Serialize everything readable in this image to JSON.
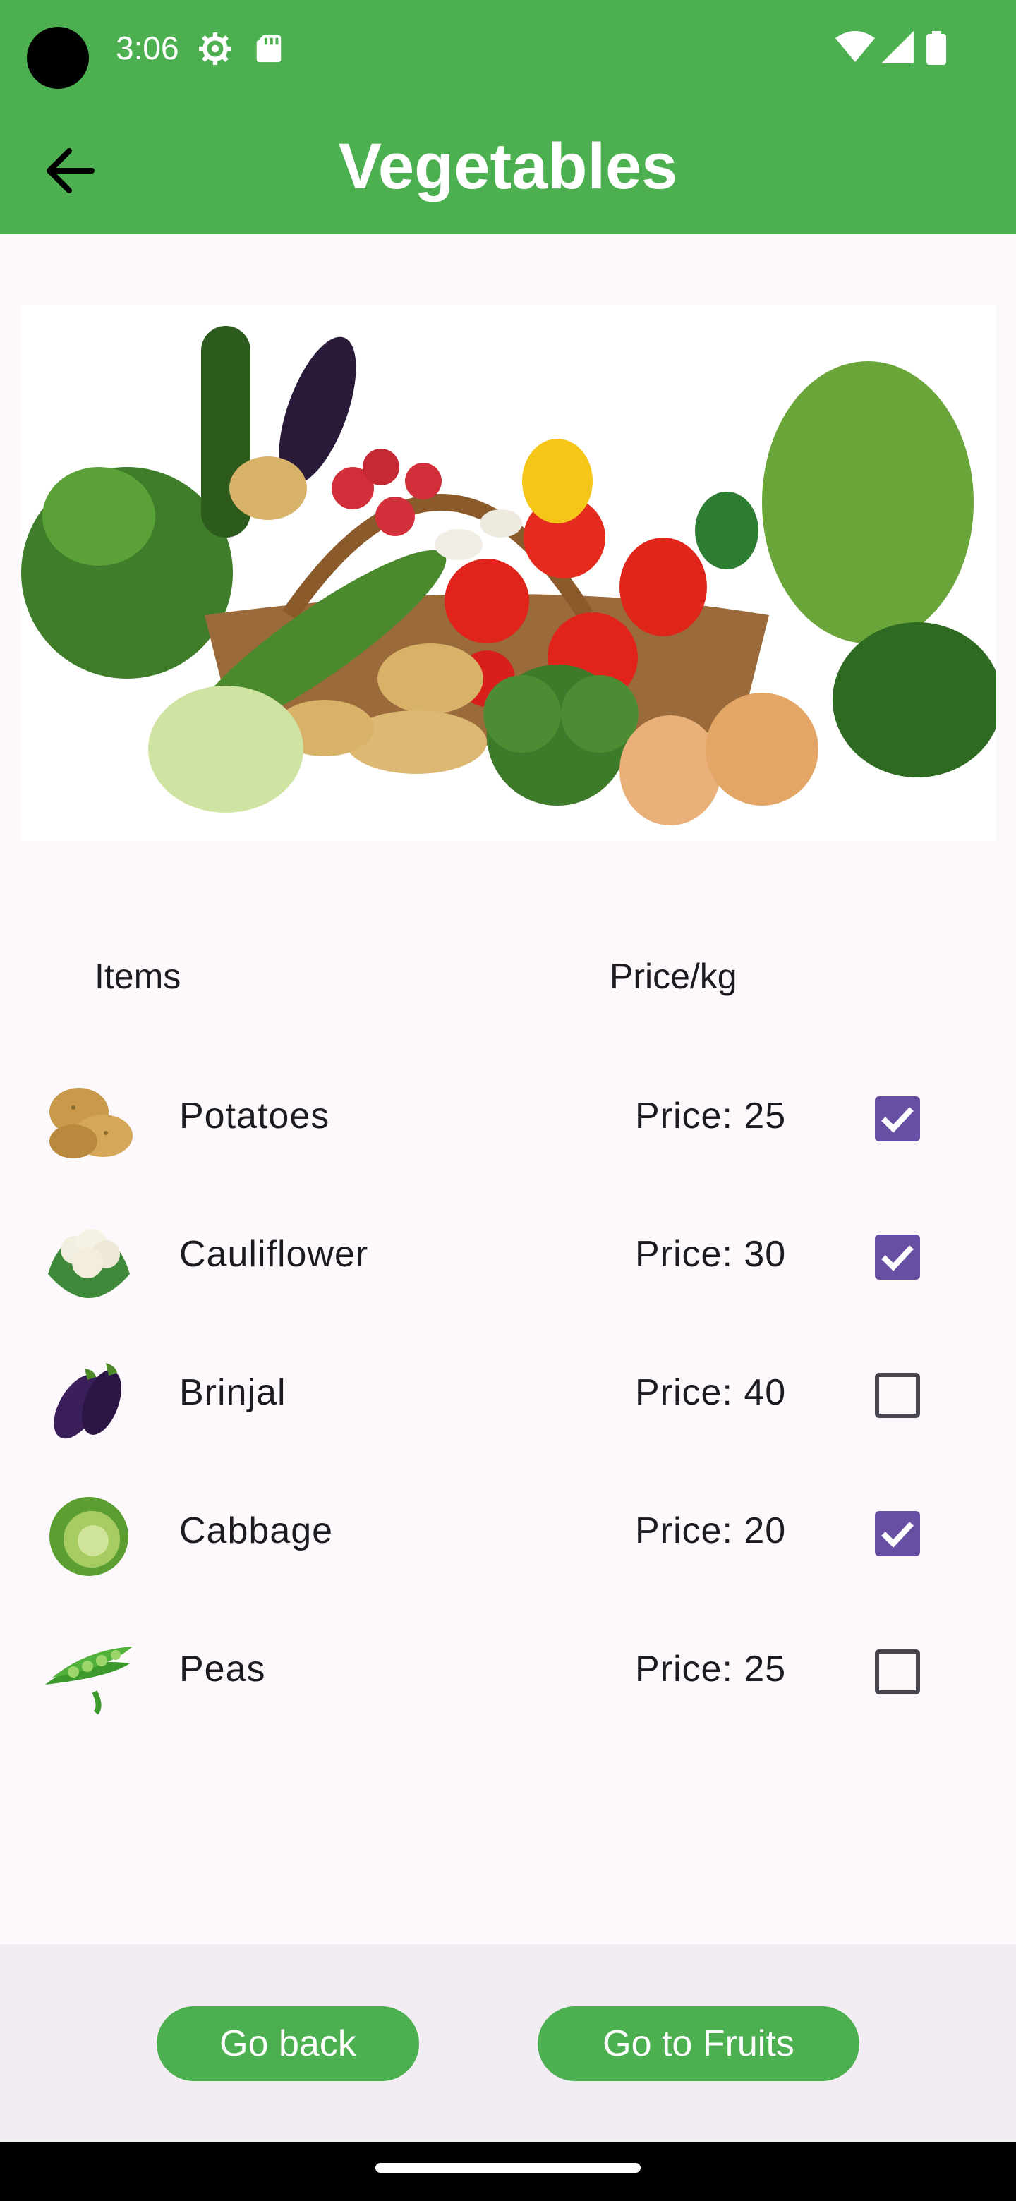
{
  "status_bar": {
    "time": "3:06",
    "icons": [
      "gear-icon",
      "sd-card-icon",
      "wifi-icon",
      "signal-icon",
      "battery-icon"
    ]
  },
  "app_bar": {
    "title": "Vegetables",
    "back_icon": "arrow-back-icon"
  },
  "hero_image": {
    "subject": "vegetable-basket"
  },
  "table": {
    "header_items": "Items",
    "header_price": "Price/kg",
    "rows": [
      {
        "name": "Potatoes",
        "price": "Price: 25",
        "checked": true,
        "icon": "potato-icon"
      },
      {
        "name": "Cauliflower",
        "price": "Price: 30",
        "checked": true,
        "icon": "cauliflower-icon"
      },
      {
        "name": "Brinjal",
        "price": "Price: 40",
        "checked": false,
        "icon": "brinjal-icon"
      },
      {
        "name": "Cabbage",
        "price": "Price: 20",
        "checked": true,
        "icon": "cabbage-icon"
      },
      {
        "name": "Peas",
        "price": "Price: 25",
        "checked": false,
        "icon": "peas-icon"
      }
    ]
  },
  "buttons": {
    "go_back": "Go back",
    "go_fruits": "Go to Fruits"
  },
  "colors": {
    "primary": "#4caf50",
    "checkbox": "#6750a4",
    "background": "#fcf8fb",
    "bottom_bar": "#f1edf2"
  }
}
